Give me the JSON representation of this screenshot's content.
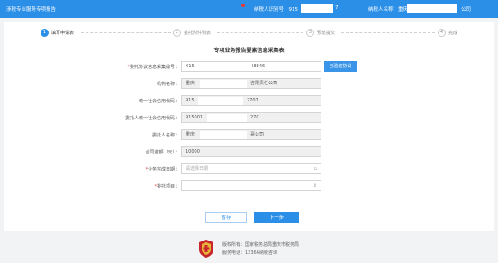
{
  "header": {
    "title": "涉税专业服务专项报告",
    "agent_id_label": "纳税人识别号：915",
    "agent_id_tail": "7",
    "agent_name_label": "纳税人名称：重庆景",
    "agent_name_tail": "公司"
  },
  "steps": [
    {
      "num": "1",
      "label": "填写申请表",
      "active": true
    },
    {
      "num": "2",
      "label": "委托附件列表",
      "active": false
    },
    {
      "num": "3",
      "label": "预览提交",
      "active": false
    },
    {
      "num": "4",
      "label": "完成",
      "active": false
    }
  ],
  "form": {
    "title": "专项业务报告要素信息采集表",
    "fields": [
      {
        "label": "委托协议信息采集编号：",
        "required": true,
        "value": "X15",
        "tail": "I8846"
      },
      {
        "label": "机构名称：",
        "required": false,
        "value": "重庆",
        "tail": "咨限责任公司"
      },
      {
        "label": "统一社会信用代码：",
        "required": false,
        "value": "915",
        "tail": "2707"
      },
      {
        "label": "委托人统一社会信用代码：",
        "required": false,
        "value": "915001",
        "tail": "27C"
      },
      {
        "label": "委托人名称：",
        "required": false,
        "value": "重庆",
        "tail": "哥公司"
      },
      {
        "label": "合同金额（元）：",
        "required": false,
        "value": "10000",
        "tail": ""
      },
      {
        "label": "业务完成日期：",
        "required": true,
        "placeholder": "请选择日期",
        "icon": "▫"
      },
      {
        "label": "委托项目：",
        "required": true,
        "value": "",
        "icon": "⇕"
      }
    ],
    "verify_button": "已验证协议",
    "save_button": "暂存",
    "next_button": "下一步"
  },
  "footer": {
    "line1": "版权所有：国家税务总局重庆市税务局",
    "line2": "服务电话：12366纳税咨询"
  },
  "colors": {
    "primary": "#2b8fe7",
    "required": "#e43a3a",
    "emblem": "#c8262d"
  }
}
